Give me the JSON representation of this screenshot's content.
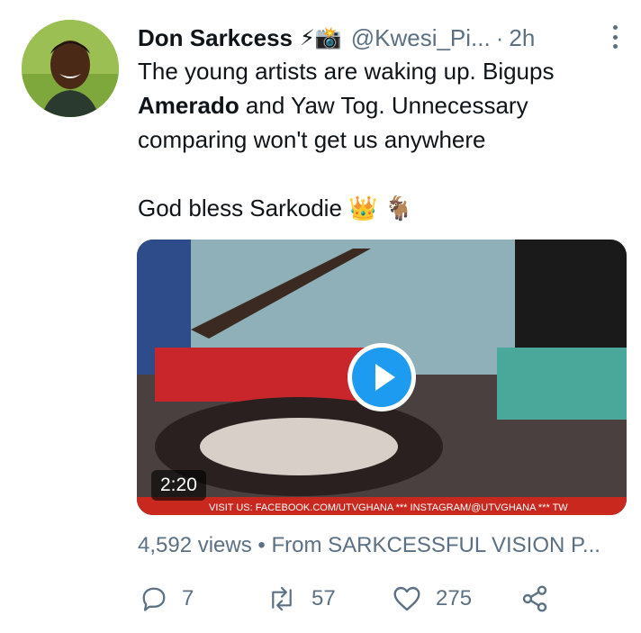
{
  "tweet": {
    "author_name": "Don Sarkcess",
    "author_emoji": "⚡📸",
    "handle": "@Kwesi_Pi...",
    "separator": "·",
    "time": "2h",
    "text_line1": "The young artists are waking up. Bigups",
    "text_bold": "Amerado",
    "text_line2_rest": " and Yaw Tog. Unnecessary",
    "text_line3": "comparing won't get us anywhere",
    "text_line4": "God bless Sarkodie 👑 🐐"
  },
  "media": {
    "duration": "2:20",
    "ticker": "VISIT US: FACEBOOK.COM/UTVGHANA *** INSTAGRAM/@UTVGHANA *** TW"
  },
  "stats": {
    "views_line": "4,592 views • From SARKCESSFUL VISION P..."
  },
  "actions": {
    "replies": "7",
    "retweets": "57",
    "likes": "275"
  },
  "colors": {
    "accent": "#1d9bf0",
    "secondary_text": "#5b7083",
    "primary_text": "#0f1419"
  }
}
